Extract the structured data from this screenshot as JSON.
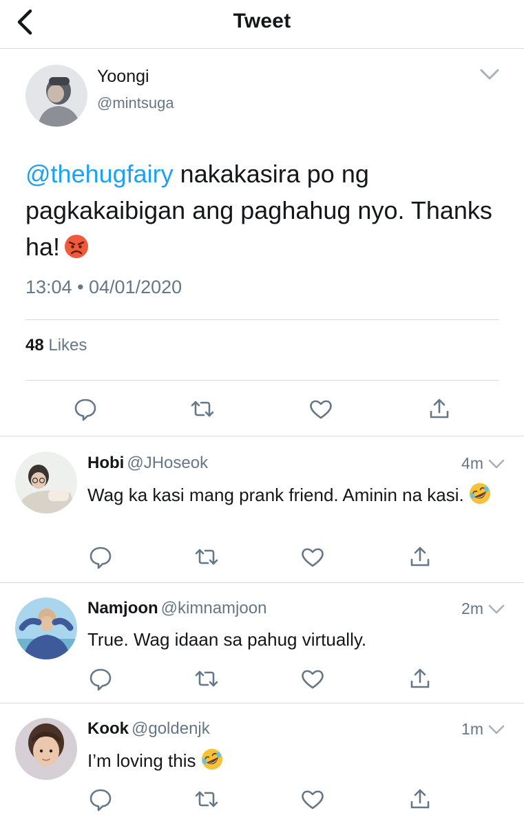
{
  "header": {
    "title": "Tweet",
    "back_icon": "chevron-left-icon"
  },
  "main_tweet": {
    "author_name": "Yoongi",
    "author_handle": "@mintsuga",
    "mention": "@thehugfairy",
    "text": " nakakasira po ng pagkakaibigan ang paghahug nyo. Thanks ha!",
    "emoji": "angry-face",
    "timestamp": "13:04 • 04/01/2020",
    "likes_count": "48",
    "likes_label": "Likes"
  },
  "replies": [
    {
      "name": "Hobi",
      "handle": "@JHoseok",
      "time": "4m",
      "text": "Wag ka kasi mang prank friend. Aminin na kasi.",
      "emoji": "rolling-on-floor-laughing"
    },
    {
      "name": "Namjoon",
      "handle": "@kimnamjoon",
      "time": "2m",
      "text": "True. Wag idaan sa pahug virtually.",
      "emoji": ""
    },
    {
      "name": "Kook",
      "handle": "@goldenjk",
      "time": "1m",
      "text": "I’m loving this",
      "emoji": "rolling-on-floor-laughing"
    }
  ],
  "icons": {
    "reply": "reply-icon",
    "retweet": "retweet-icon",
    "like": "heart-icon",
    "share": "share-icon",
    "more": "chevron-down-icon"
  },
  "colors": {
    "mention": "#1da1f2",
    "secondary_text": "#657786",
    "primary_text": "#14171a",
    "divider": "#d9d9d9"
  }
}
